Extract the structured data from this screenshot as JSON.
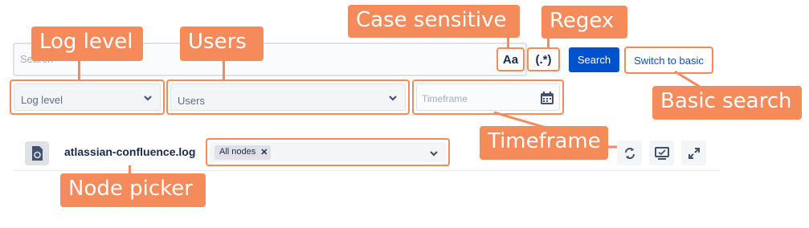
{
  "search": {
    "placeholder": "Search",
    "case_sensitive_label": "Aa",
    "regex_label": "(.*)",
    "search_button": "Search",
    "switch_link": "Switch to basic"
  },
  "filters": {
    "log_level": "Log level",
    "users": "Users",
    "timeframe": "Timeframe"
  },
  "file": {
    "name": "atlassian-confluence.log",
    "node_tag": "All nodes"
  },
  "annotations": {
    "log_level": "Log level",
    "users": "Users",
    "case_sensitive": "Case sensitive",
    "regex": "Regex",
    "basic_search": "Basic search",
    "timeframe": "Timeframe",
    "node_picker": "Node picker"
  },
  "colors": {
    "accent": "#f58a5a",
    "primary_button": "#0052cc"
  },
  "icons": [
    "chevron-down-icon",
    "calendar-icon",
    "file-icon",
    "refresh-icon",
    "screen-icon",
    "expand-icon",
    "close-icon"
  ]
}
